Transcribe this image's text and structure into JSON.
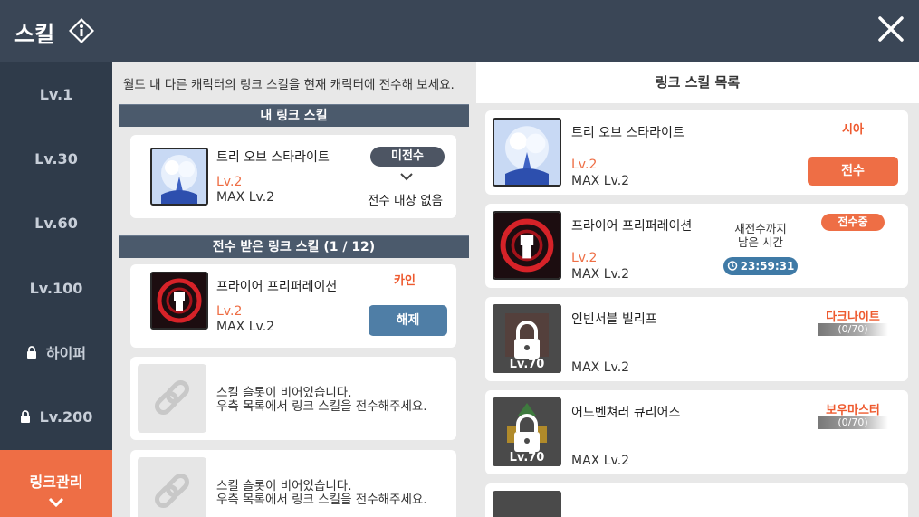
{
  "header": {
    "title": "스킬"
  },
  "sidebar": {
    "items": [
      {
        "label": "Lv.1",
        "locked": false
      },
      {
        "label": "Lv.30",
        "locked": false
      },
      {
        "label": "Lv.60",
        "locked": false
      },
      {
        "label": "Lv.100",
        "locked": false
      },
      {
        "label": "하이퍼",
        "locked": true
      },
      {
        "label": "Lv.200",
        "locked": true
      },
      {
        "label": "링크관리",
        "locked": false,
        "active": true
      }
    ]
  },
  "left": {
    "description": "월드 내 다른 캐릭터의 링크 스킬을 현재 캐릭터에 전수해 보세요.",
    "my_section_title": "내 링크 스킬",
    "my_skill": {
      "name": "트리 오브 스타라이트",
      "level": "Lv.2",
      "max_level": "MAX Lv.2",
      "status_pill": "미전수",
      "status_text": "전수 대상 없음"
    },
    "received_section_title": "전수 받은 링크 스킬  (1 / 12)",
    "received_skill": {
      "name": "프라이어 프리퍼레이션",
      "owner": "카인",
      "level": "Lv.2",
      "max_level": "MAX Lv.2",
      "button": "해제"
    },
    "empty_slot": {
      "line1": "스킬 슬롯이 비어있습니다.",
      "line2": "우측 목록에서 링크 스킬을 전수해주세요."
    }
  },
  "right": {
    "title": "링크 스킬 목록",
    "items": [
      {
        "name": "트리 오브 스타라이트",
        "owner": "시아",
        "level": "Lv.2",
        "max_level": "MAX Lv.2",
        "button": "전수"
      },
      {
        "name": "프라이어 프리퍼레이션",
        "badge": "전수중",
        "level": "Lv.2",
        "max_level": "MAX Lv.2",
        "timer_label_1": "재전수까지",
        "timer_label_2": "남은 시간",
        "timer": "23:59:31"
      },
      {
        "name": "인빈서블 빌리프",
        "owner": "다크나이트",
        "progress": "(0/70)",
        "lock_level": "Lv.70",
        "max_level": "MAX Lv.2"
      },
      {
        "name": "어드벤쳐러 큐리어스",
        "owner": "보우마스터",
        "progress": "(0/70)",
        "lock_level": "Lv.70",
        "max_level": "MAX Lv.2"
      }
    ]
  }
}
